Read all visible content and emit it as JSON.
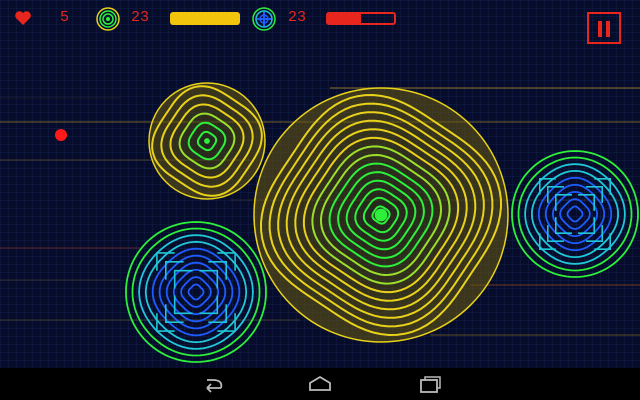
{
  "hud": {
    "lives": "5",
    "green_orb_count": "23",
    "blue_orb_count": "23",
    "green_energy_level": 1.0,
    "red_energy_level": 0.5
  },
  "colors": {
    "background": "#060c2a",
    "hud_red": "#e8261e",
    "energy_yellow": "#f2c40c",
    "ring_yellow": "#e8d21a",
    "ring_green": "#2cf03a",
    "ring_blue": "#1e5cff",
    "ring_teal": "#1ec8d8"
  },
  "icons": {
    "lives": "heart-icon",
    "green_orb": "green-orb-icon",
    "blue_orb": "blue-orb-icon",
    "pause": "pause-icon",
    "back": "back-icon",
    "home": "home-icon",
    "recents": "recents-icon"
  }
}
